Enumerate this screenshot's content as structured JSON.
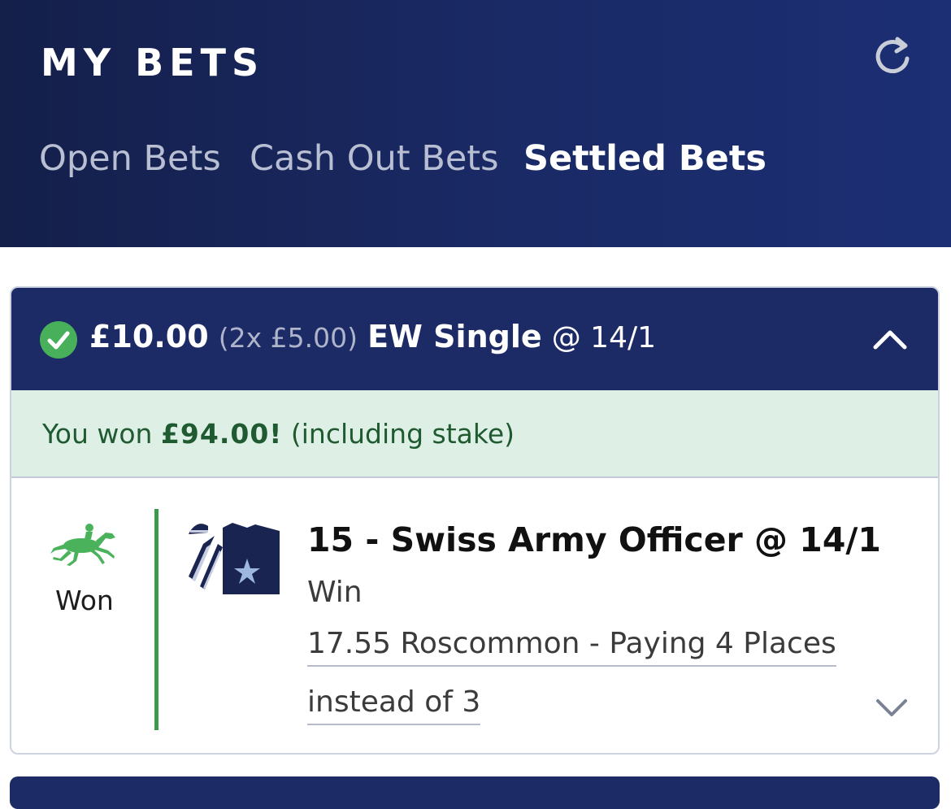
{
  "header": {
    "title": "MY BETS",
    "refresh_icon": "refresh-icon",
    "background_color": "#1a2a66"
  },
  "tabs": [
    {
      "label": "Open Bets",
      "active": false
    },
    {
      "label": "Cash Out Bets",
      "active": false
    },
    {
      "label": "Settled Bets",
      "active": true
    }
  ],
  "bet": {
    "status_icon": "check-circle-icon",
    "stake": "£10.00",
    "stake_split": "(2x £5.00)",
    "bet_type": "EW Single",
    "odds": "@ 14/1",
    "collapse_icon": "chevron-up-icon",
    "won_prefix": "You won",
    "won_amount": "£94.00!",
    "won_suffix": "(including stake)",
    "result_icon": "racehorse-icon",
    "result": "Won",
    "selection": "15 - Swiss Army Officer @ 14/1",
    "market": "Win",
    "event_line1": "17.55 Roscommon - Paying 4 Places",
    "event_line2": "instead of 3",
    "expand_icon": "chevron-down-icon",
    "accent_green": "#3d9a4b",
    "banner_color": "#deefe6"
  }
}
